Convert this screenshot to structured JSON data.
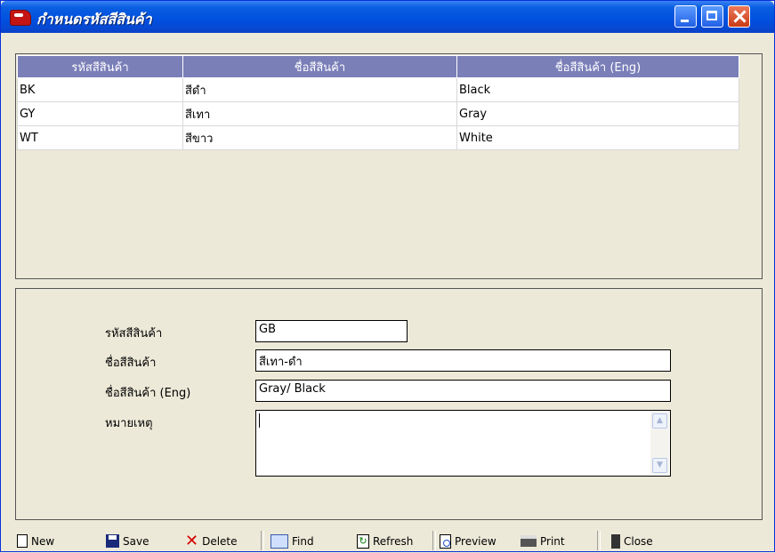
{
  "window": {
    "title": "กำหนดรหัสสีสินค้า",
    "controls": {
      "minimize": "minimize-icon",
      "maximize": "maximize-icon",
      "close": "close-icon"
    }
  },
  "grid": {
    "headers": [
      "รหัสสีสินค้า",
      "ชื่อสีสินค้า",
      "ชื่อสีสินค้า (Eng)"
    ],
    "rows": [
      [
        "BK",
        "สีดำ",
        "Black"
      ],
      [
        "GY",
        "สีเทา",
        "Gray"
      ],
      [
        "WT",
        "สีขาว",
        "White"
      ]
    ],
    "header_color": "#7a7fb8"
  },
  "form": {
    "code_label": "รหัสสีสินค้า",
    "code_value": "GB",
    "name_label": "ชื่อสีสินค้า",
    "name_value": "สีเทา-ดำ",
    "name_eng_label": "ชื่อสีสินค้า (Eng)",
    "name_eng_value": "Gray/ Black",
    "remark_label": "หมายเหตุ",
    "remark_value": ""
  },
  "toolbar": {
    "new": "New",
    "save": "Save",
    "delete": "Delete",
    "find": "Find",
    "refresh": "Refresh",
    "preview": "Preview",
    "print": "Print",
    "close": "Close"
  }
}
